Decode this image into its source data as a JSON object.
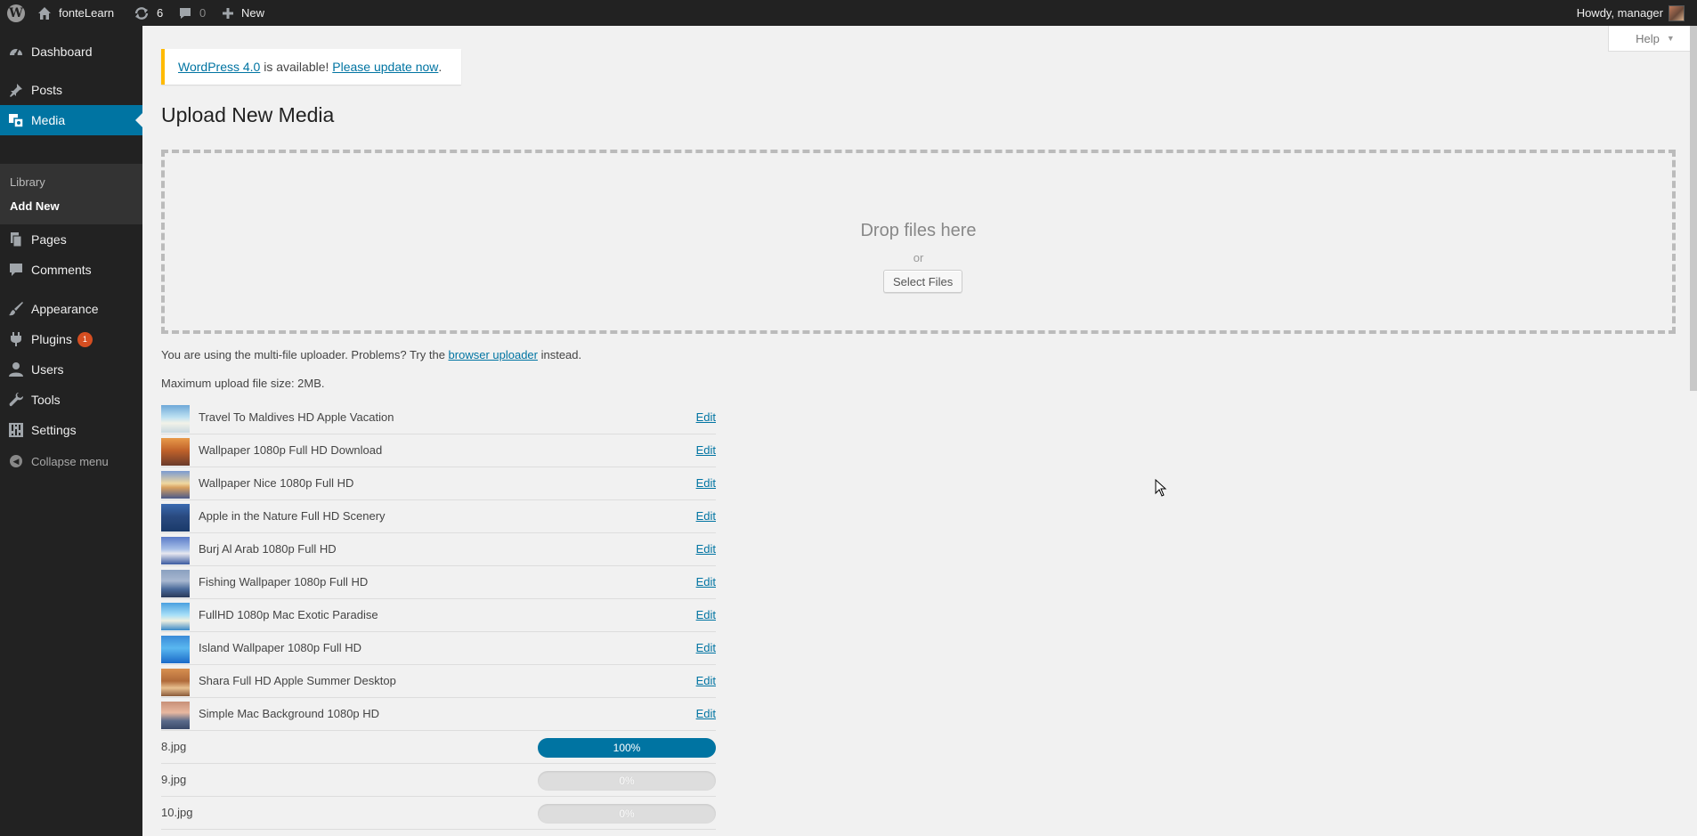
{
  "adminbar": {
    "site_name": "fonteLearn",
    "updates_count": "6",
    "comments_count": "0",
    "new_label": "New",
    "greeting": "Howdy, manager"
  },
  "sidebar": {
    "items": [
      {
        "label": "Dashboard",
        "icon": "dashboard-icon"
      },
      {
        "label": "Posts",
        "icon": "pin-icon"
      },
      {
        "label": "Media",
        "icon": "media-icon"
      },
      {
        "label": "Pages",
        "icon": "pages-icon"
      },
      {
        "label": "Comments",
        "icon": "comment-icon"
      },
      {
        "label": "Appearance",
        "icon": "brush-icon"
      },
      {
        "label": "Plugins",
        "icon": "plugin-icon",
        "badge": "1"
      },
      {
        "label": "Users",
        "icon": "user-icon"
      },
      {
        "label": "Tools",
        "icon": "wrench-icon"
      },
      {
        "label": "Settings",
        "icon": "settings-icon"
      }
    ],
    "submenu": [
      "Library",
      "Add New"
    ],
    "collapse_label": "Collapse menu"
  },
  "help_label": "Help",
  "notice": {
    "link_version": "WordPress 4.0",
    "middle": " is available! ",
    "link_update": "Please update now",
    "end": "."
  },
  "page_title": "Upload New Media",
  "dropzone": {
    "drop_text": "Drop files here",
    "or_text": "or",
    "button_label": "Select Files"
  },
  "uploader_note": {
    "before": "You are using the multi-file uploader. Problems? Try the ",
    "link": "browser uploader",
    "after": " instead."
  },
  "max_size": "Maximum upload file size: 2MB.",
  "media_items": [
    {
      "title": "Travel To Maldives HD Apple Vacation",
      "edit": "Edit"
    },
    {
      "title": "Wallpaper 1080p Full HD Download",
      "edit": "Edit"
    },
    {
      "title": "Wallpaper Nice 1080p Full HD",
      "edit": "Edit"
    },
    {
      "title": "Apple in the Nature Full HD Scenery",
      "edit": "Edit"
    },
    {
      "title": "Burj Al Arab 1080p Full HD",
      "edit": "Edit"
    },
    {
      "title": "Fishing Wallpaper 1080p Full HD",
      "edit": "Edit"
    },
    {
      "title": "FullHD 1080p Mac Exotic Paradise",
      "edit": "Edit"
    },
    {
      "title": "Island Wallpaper 1080p Full HD",
      "edit": "Edit"
    },
    {
      "title": "Shara Full HD Apple Summer Desktop",
      "edit": "Edit"
    },
    {
      "title": "Simple Mac Background 1080p HD",
      "edit": "Edit"
    }
  ],
  "uploads": [
    {
      "filename": "8.jpg",
      "percent_label": "100%",
      "progress": 1.0
    },
    {
      "filename": "9.jpg",
      "percent_label": "0%",
      "progress": 0.0
    },
    {
      "filename": "10.jpg",
      "percent_label": "0%",
      "progress": 0.0
    }
  ],
  "colors": {
    "accent": "#0074a2",
    "notice_border": "#ffba00",
    "badge": "#d54e21",
    "sidebar_bg": "#222222"
  }
}
